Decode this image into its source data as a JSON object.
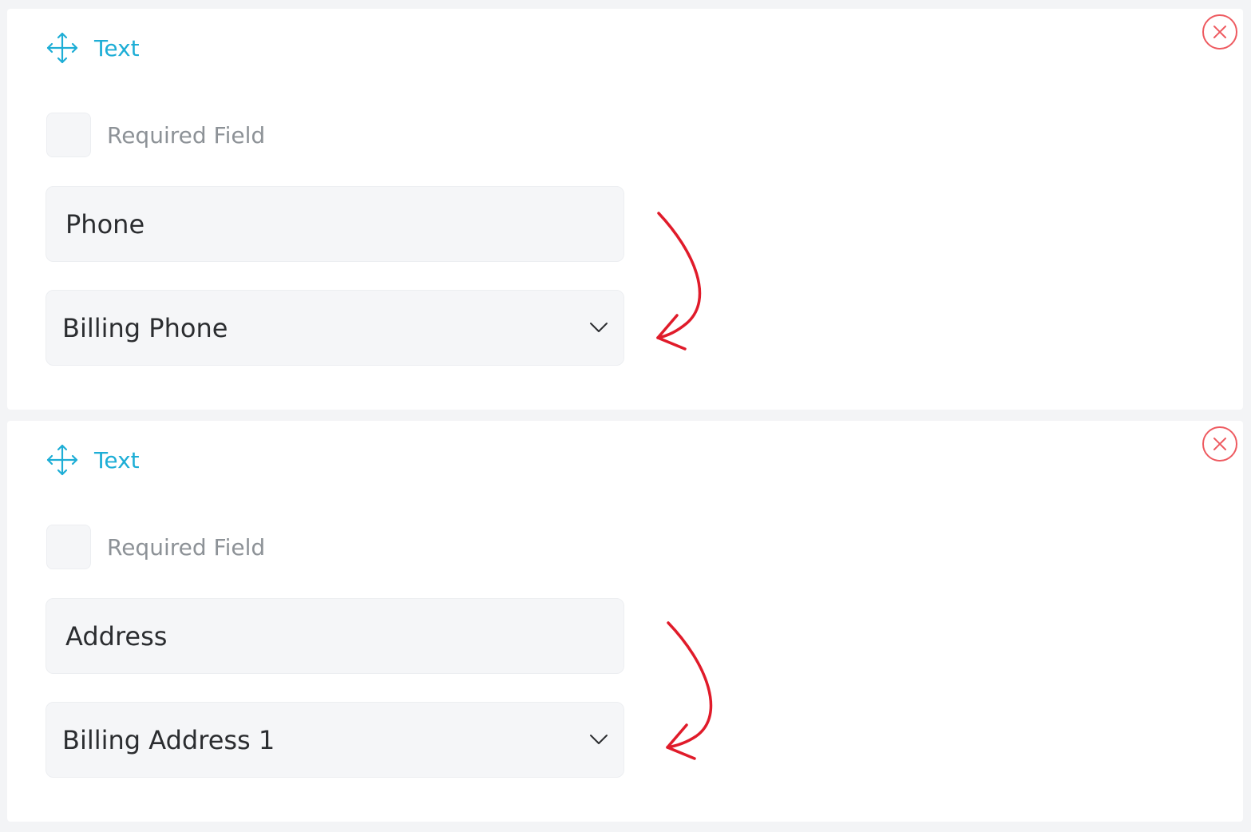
{
  "accent_color": "#1eaed6",
  "danger_color": "#ee5a60",
  "annotation_color": "#e01b2a",
  "fields": [
    {
      "type_label": "Text",
      "required_label": "Required Field",
      "required_checked": false,
      "label_value": "Phone",
      "mapping_value": "Billing Phone",
      "icons": {
        "drag": "move-icon",
        "remove": "close-circle-icon",
        "dropdown": "chevron-down-icon"
      }
    },
    {
      "type_label": "Text",
      "required_label": "Required Field",
      "required_checked": false,
      "label_value": "Address",
      "mapping_value": "Billing Address 1",
      "icons": {
        "drag": "move-icon",
        "remove": "close-circle-icon",
        "dropdown": "chevron-down-icon"
      }
    }
  ]
}
